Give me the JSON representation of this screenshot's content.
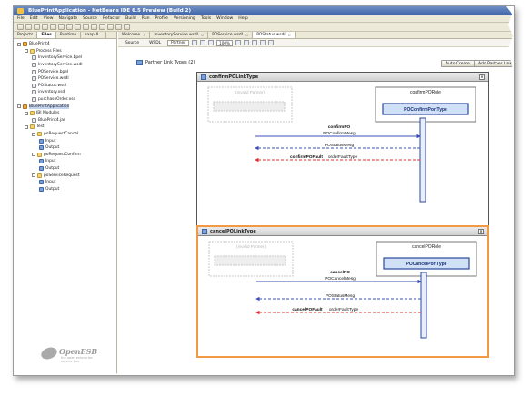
{
  "window": {
    "title": "BluePrintApplication - NetBeans IDE 6.5 Preview (Build 2)"
  },
  "menu": [
    "File",
    "Edit",
    "View",
    "Navigate",
    "Source",
    "Refactor",
    "Build",
    "Run",
    "Profile",
    "Versioning",
    "Tools",
    "Window",
    "Help"
  ],
  "left_panel": {
    "tabs": [
      "Projects",
      "Files",
      "Runtime",
      "soapUI..."
    ],
    "tree": [
      {
        "label": "BluePrint4",
        "level": 0,
        "icon": "project",
        "toggle": true
      },
      {
        "label": "Process Files",
        "level": 1,
        "icon": "folder",
        "toggle": true
      },
      {
        "label": "InventoryService.bpel",
        "level": 2,
        "icon": "file"
      },
      {
        "label": "InventoryService.wsdl",
        "level": 2,
        "icon": "file"
      },
      {
        "label": "POService.bpel",
        "level": 2,
        "icon": "file"
      },
      {
        "label": "POService.wsdl",
        "level": 2,
        "icon": "file"
      },
      {
        "label": "POStatus.wsdl",
        "level": 2,
        "icon": "file"
      },
      {
        "label": "inventory.xsd",
        "level": 2,
        "icon": "file"
      },
      {
        "label": "purchaseOrder.xsd",
        "level": 2,
        "icon": "file"
      },
      {
        "label": "BluePrintApplication",
        "level": 0,
        "icon": "project",
        "toggle": true,
        "selected": true
      },
      {
        "label": "JBI Modules",
        "level": 1,
        "icon": "folder",
        "toggle": true
      },
      {
        "label": "BluePrint4.jar",
        "level": 2,
        "icon": "file"
      },
      {
        "label": "Test",
        "level": 1,
        "icon": "folder",
        "toggle": true
      },
      {
        "label": "poRequestCancel",
        "level": 2,
        "icon": "folder",
        "toggle": true
      },
      {
        "label": "Input",
        "level": 3,
        "icon": "port"
      },
      {
        "label": "Output",
        "level": 3,
        "icon": "port"
      },
      {
        "label": "poRequestConfirm",
        "level": 2,
        "icon": "folder",
        "toggle": true
      },
      {
        "label": "Input",
        "level": 3,
        "icon": "port"
      },
      {
        "label": "Output",
        "level": 3,
        "icon": "port"
      },
      {
        "label": "poServiceRequest",
        "level": 2,
        "icon": "folder",
        "toggle": true
      },
      {
        "label": "Input",
        "level": 3,
        "icon": "port"
      },
      {
        "label": "Output",
        "level": 3,
        "icon": "port"
      }
    ],
    "logo": {
      "name": "OpenESB",
      "tagline": "the open enterprise service bus"
    }
  },
  "editor": {
    "tabs": [
      {
        "label": "Welcome",
        "active": false
      },
      {
        "label": "InventoryService.wsdl",
        "active": false
      },
      {
        "label": "POService.wsdl",
        "active": false
      },
      {
        "label": "POStatus.wsdl",
        "active": true
      }
    ],
    "view_buttons": [
      "Source",
      "WSDL",
      "Partner"
    ],
    "active_view": "Partner",
    "zoom": "100%",
    "section_title": "Partner Link Types (2)",
    "auto_create_label": "Auto Create",
    "add_plt_label": "Add Partner Link..."
  },
  "partner_link_types": [
    {
      "name": "confirmPOLinkType",
      "left_role": "(Invalid Partner)",
      "right_role": "confirmPORole",
      "port_type": "POConfirmPortType",
      "messages": [
        {
          "op": "confirmPO",
          "msg": "POConfirmMesg",
          "dir": "right",
          "style": "solid",
          "color": "#3a4fb8"
        },
        {
          "op": "",
          "msg": "POStatusMesg",
          "dir": "left",
          "style": "dashed",
          "color": "#3a4fb8"
        },
        {
          "op": "confirmPOFault",
          "msg": "orderFaultType",
          "dir": "left",
          "style": "dashed",
          "color": "#e03030"
        }
      ],
      "highlighted": false
    },
    {
      "name": "cancelPOLinkType",
      "left_role": "(Invalid Partner)",
      "right_role": "cancelPORole",
      "port_type": "POCancelPortType",
      "messages": [
        {
          "op": "cancelPO",
          "msg": "POCancelMesg",
          "dir": "right",
          "style": "solid",
          "color": "#3a4fb8"
        },
        {
          "op": "",
          "msg": "POStatusMesg",
          "dir": "left",
          "style": "dashed",
          "color": "#3a4fb8"
        },
        {
          "op": "cancelPOFault",
          "msg": "orderFaultType",
          "dir": "left",
          "style": "dashed",
          "color": "#e03030"
        }
      ],
      "highlighted": true
    }
  ]
}
